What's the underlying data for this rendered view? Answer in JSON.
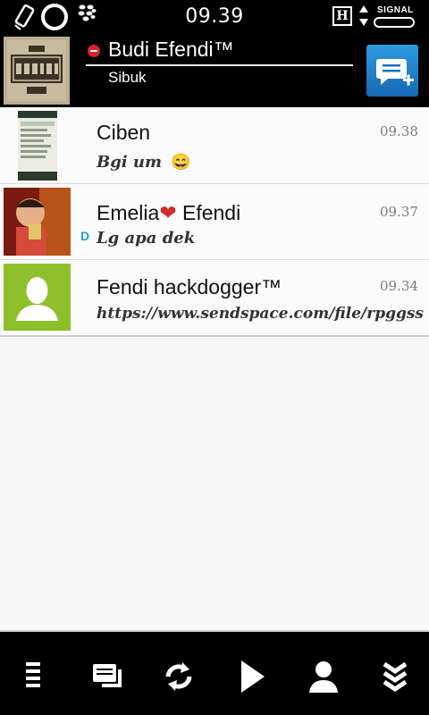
{
  "status_bar": {
    "time": "09.39",
    "network_letter": "H",
    "signal_label": "SIGNAL",
    "icons": [
      "phone-vibrate-icon",
      "ring-icon",
      "blackberry-icon",
      "network-h-icon",
      "data-arrows-icon",
      "battery-icon"
    ]
  },
  "profile": {
    "name": "Budi Efendi™",
    "status": "Sibuk",
    "status_color": "#d9232b",
    "new_chat_icon": "new-chat-icon"
  },
  "chats": [
    {
      "name": "Ciben",
      "time": "09.38",
      "message": "Bgi um",
      "emoji": "😄"
    },
    {
      "name_first": "Emelia",
      "name_last": "Efendi",
      "heart": "❤",
      "time": "09.37",
      "message": "Lg apa dek",
      "delivered": "D"
    },
    {
      "name": "Fendi hackdogger™",
      "time": "09.34",
      "message": "https://www.sendspace.com/file/rpggss"
    }
  ],
  "toolbar": {
    "icons": [
      "menu-icon",
      "chats-icon",
      "refresh-icon",
      "play-icon",
      "contact-icon",
      "scroll-down-icon"
    ]
  },
  "colors": {
    "accent": "#1b7fcc",
    "header_bg": "#000000",
    "list_bg": "#fafafa"
  }
}
